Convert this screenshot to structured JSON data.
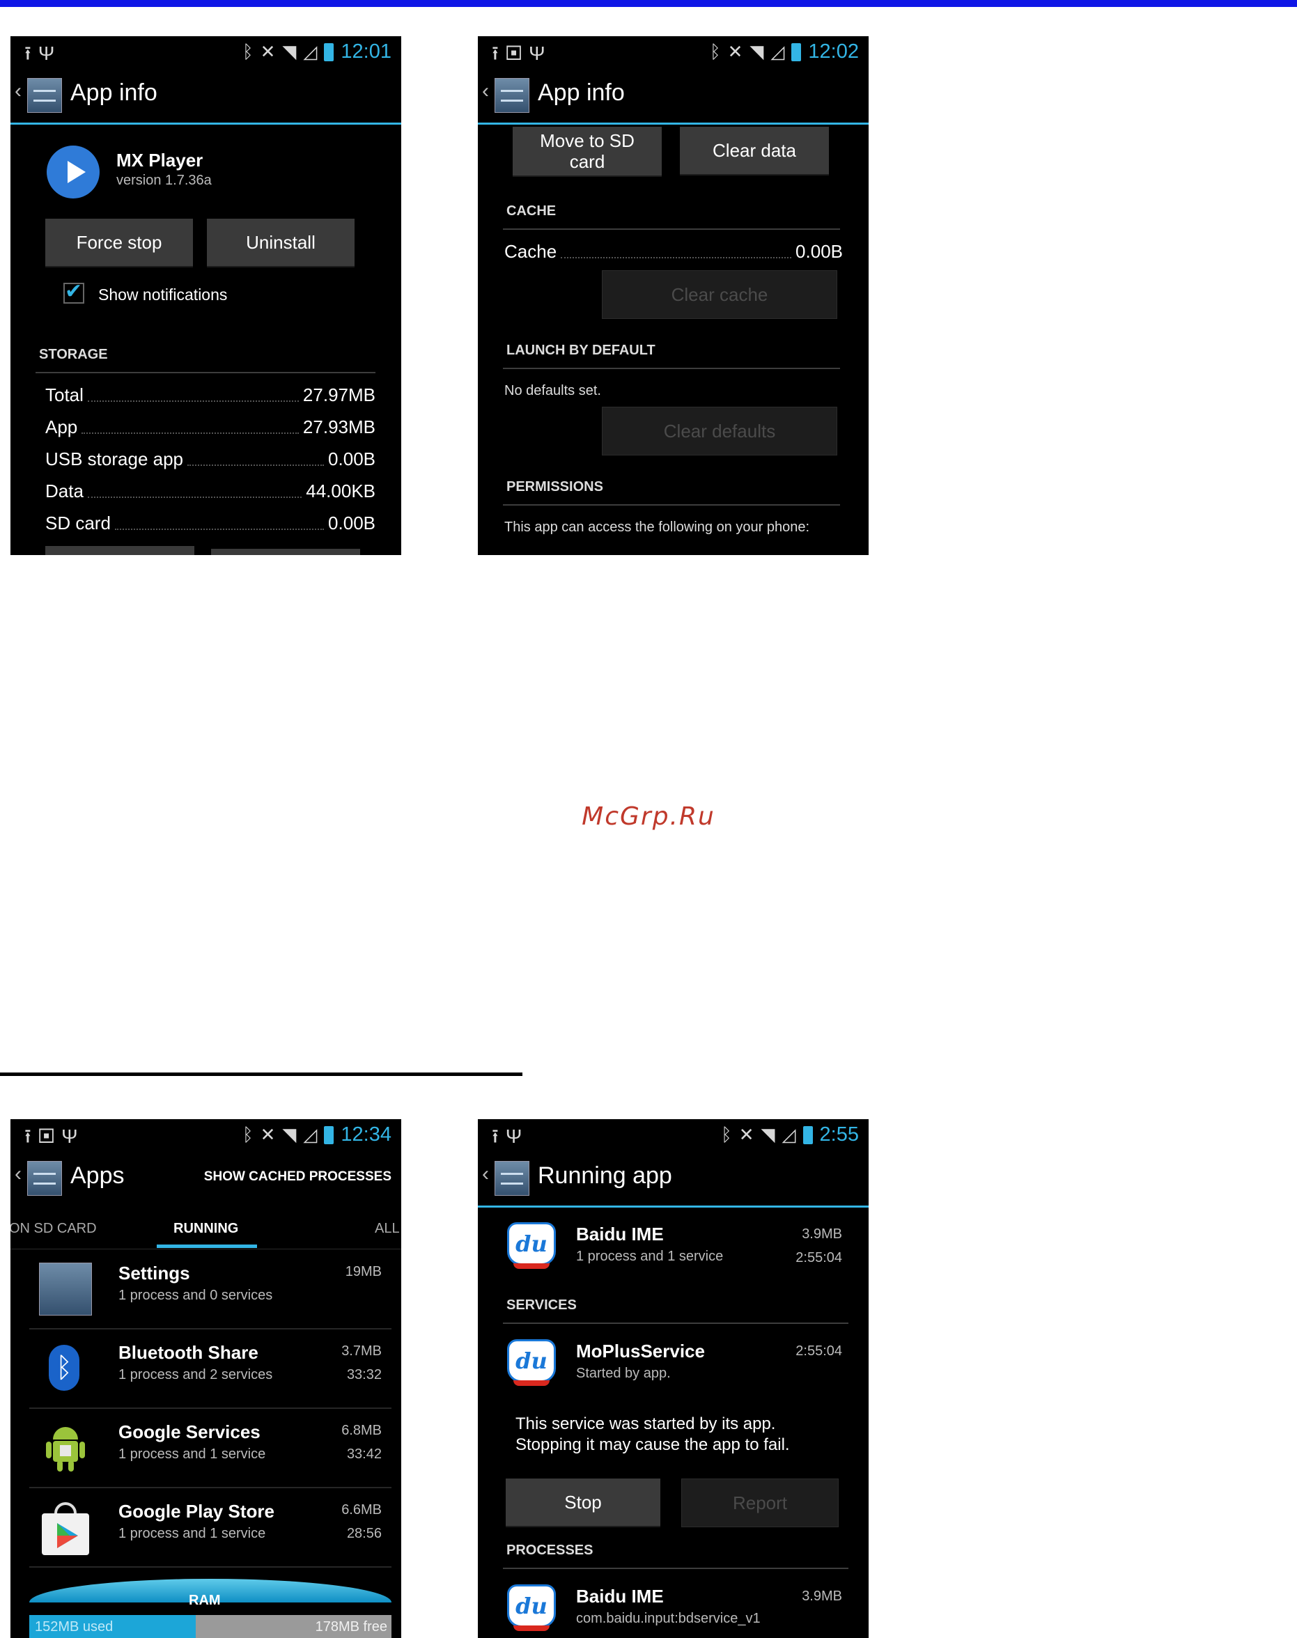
{
  "watermark": "McGrp.Ru",
  "screen1": {
    "time": "12:01",
    "title": "App info",
    "app_name": "MX Player",
    "app_version": "version 1.7.36a",
    "force_stop": "Force stop",
    "uninstall": "Uninstall",
    "show_notifications": "Show notifications",
    "storage_header": "STORAGE",
    "storage_rows": [
      {
        "label": "Total",
        "value": "27.97MB"
      },
      {
        "label": "App",
        "value": "27.93MB"
      },
      {
        "label": "USB storage app",
        "value": "0.00B"
      },
      {
        "label": "Data",
        "value": "44.00KB"
      },
      {
        "label": "SD card",
        "value": "0.00B"
      }
    ]
  },
  "screen2": {
    "time": "12:02",
    "title": "App info",
    "move_to_sd": "Move to SD card",
    "clear_data": "Clear data",
    "cache_header": "CACHE",
    "cache_label": "Cache",
    "cache_value": "0.00B",
    "clear_cache": "Clear cache",
    "launch_header": "LAUNCH BY DEFAULT",
    "no_defaults": "No defaults set.",
    "clear_defaults": "Clear defaults",
    "permissions_header": "PERMISSIONS",
    "permissions_text": "This app can access the following on your phone:"
  },
  "screen3": {
    "time": "12:34",
    "title": "Apps",
    "action": "SHOW CACHED PROCESSES",
    "tabs": [
      "ON SD CARD",
      "RUNNING",
      "ALL"
    ],
    "apps": [
      {
        "name": "Settings",
        "sub": "1 process and 0 services",
        "size": "19MB",
        "time": ""
      },
      {
        "name": "Bluetooth Share",
        "sub": "1 process and 2 services",
        "size": "3.7MB",
        "time": "33:32"
      },
      {
        "name": "Google Services",
        "sub": "1 process and 1 service",
        "size": "6.8MB",
        "time": "33:42"
      },
      {
        "name": "Google Play Store",
        "sub": "1 process and 1 service",
        "size": "6.6MB",
        "time": "28:56"
      }
    ],
    "ram_label": "RAM",
    "ram_used": "152MB used",
    "ram_free": "178MB free",
    "ram_used_fraction": 0.46
  },
  "screen4": {
    "time": "2:55",
    "title": "Running app",
    "top_app": {
      "name": "Baidu IME",
      "sub": "1 process and 1 service",
      "size": "3.9MB",
      "time": "2:55:04"
    },
    "services_header": "SERVICES",
    "service": {
      "name": "MoPlusService",
      "sub": "Started by app.",
      "time": "2:55:04"
    },
    "service_note_1": "This service was started by its app.",
    "service_note_2": "Stopping it may cause the app to fail.",
    "stop": "Stop",
    "report": "Report",
    "processes_header": "PROCESSES",
    "process": {
      "name": "Baidu IME",
      "sub": "com.baidu.input:bdservice_v1",
      "size": "3.9MB"
    }
  },
  "colors": {
    "accent": "#33b5e5",
    "topbar": "#0f16e6",
    "watermark": "#c0392b"
  },
  "icons": [
    "upload-icon",
    "usb-icon",
    "image-icon",
    "bluetooth-icon",
    "mute-icon",
    "wifi-icon",
    "signal-icon",
    "battery-icon",
    "settings-icon",
    "play-icon",
    "checkbox-icon",
    "baidu-icon",
    "android-icon",
    "play-store-icon"
  ]
}
